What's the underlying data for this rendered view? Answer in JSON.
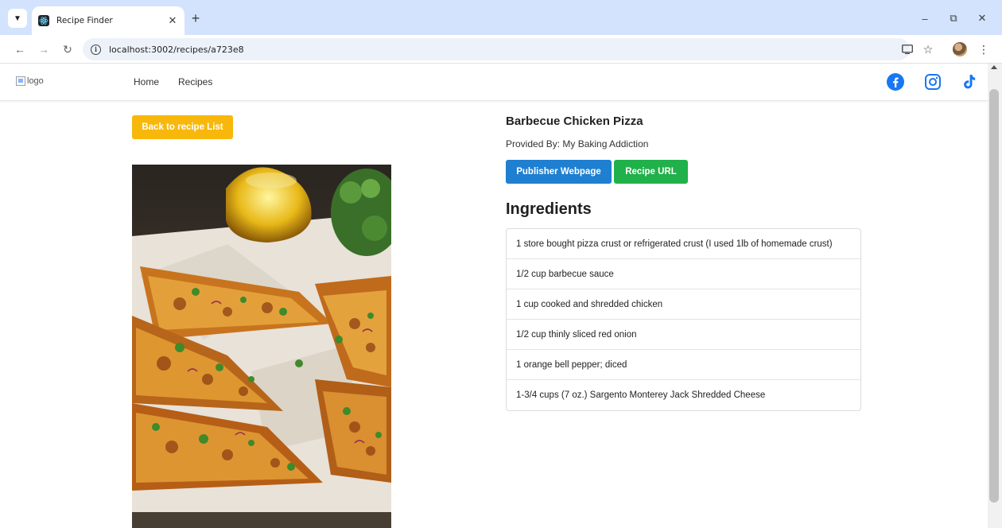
{
  "browser": {
    "tab_title": "Recipe Finder",
    "url": "localhost:3002/recipes/a723e8"
  },
  "site": {
    "logo_alt": "logo",
    "nav": [
      "Home",
      "Recipes"
    ],
    "social_icons": [
      "facebook-icon",
      "instagram-icon",
      "tiktok-icon"
    ]
  },
  "recipe": {
    "back_label": "Back to recipe List",
    "title": "Barbecue Chicken Pizza",
    "provider": "Provided By: My Baking Addiction",
    "publisher_button": "Publisher Webpage",
    "recipe_url_button": "Recipe URL",
    "ingredients_heading": "Ingredients",
    "ingredients": [
      "1 store bought pizza crust or refrigerated crust (I used 1lb of homemade crust)",
      "1/2 cup barbecue sauce",
      "1 cup cooked and shredded chicken",
      "1/2 cup thinly sliced red onion",
      "1 orange bell pepper; diced",
      "1-3/4 cups (7 oz.) Sargento Monterey Jack Shredded Cheese"
    ]
  },
  "colors": {
    "back_button": "#f8b70b",
    "publisher_button": "#1f7fd1",
    "recipe_url_button": "#21b14b",
    "facebook": "#1877f2",
    "instagram": "#1877f2",
    "tiktok": "#1877f2"
  }
}
